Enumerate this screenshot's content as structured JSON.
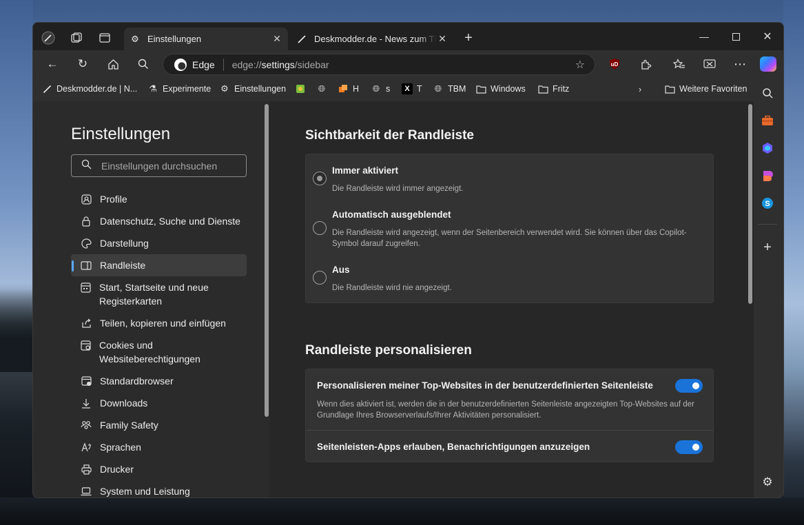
{
  "tabs": [
    {
      "label": "Einstellungen",
      "active": true,
      "icon": "gear-icon"
    },
    {
      "label": "Deskmodder.de - News zum Thema",
      "active": false,
      "icon": "feather-icon"
    }
  ],
  "toolbar": {
    "edge_label": "Edge",
    "url_prefix": "edge://",
    "url_bright": "settings",
    "url_suffix": "/sidebar",
    "ublock_label": "uD"
  },
  "favorites": [
    {
      "label": "Deskmodder.de | N...",
      "icon": "feather-icon"
    },
    {
      "label": "Experimente",
      "icon": "flask-icon"
    },
    {
      "label": "Einstellungen",
      "icon": "gear-icon"
    },
    {
      "label": "",
      "icon": "green-app-icon"
    },
    {
      "label": "",
      "icon": "globe-icon"
    },
    {
      "label": "H",
      "icon": "orange-app-icon"
    },
    {
      "label": "s",
      "icon": "globe-icon"
    },
    {
      "label": "T",
      "icon": "x-logo-icon"
    },
    {
      "label": "TBM",
      "icon": "globe-icon"
    },
    {
      "label": "Windows",
      "icon": "folder-icon"
    },
    {
      "label": "Fritz",
      "icon": "folder-icon"
    },
    {
      "label": "Weitere Favoriten",
      "icon": "folder-icon"
    }
  ],
  "settings": {
    "title": "Einstellungen",
    "search_placeholder": "Einstellungen durchsuchen",
    "nav": [
      {
        "label": "Profile",
        "icon": "profile-icon"
      },
      {
        "label": "Datenschutz, Suche und Dienste",
        "icon": "lock-icon"
      },
      {
        "label": "Darstellung",
        "icon": "palette-icon"
      },
      {
        "label": "Randleiste",
        "icon": "sidebar-icon",
        "selected": true
      },
      {
        "label": "Start, Startseite und neue Registerkarten",
        "icon": "home-grid-icon"
      },
      {
        "label": "Teilen, kopieren und einfügen",
        "icon": "share-icon"
      },
      {
        "label": "Cookies und Websiteberechtigungen",
        "icon": "cookie-icon"
      },
      {
        "label": "Standardbrowser",
        "icon": "browser-icon"
      },
      {
        "label": "Downloads",
        "icon": "download-icon"
      },
      {
        "label": "Family Safety",
        "icon": "family-icon"
      },
      {
        "label": "Sprachen",
        "icon": "language-icon"
      },
      {
        "label": "Drucker",
        "icon": "printer-icon"
      },
      {
        "label": "System und Leistung",
        "icon": "laptop-icon"
      }
    ]
  },
  "visibility": {
    "title": "Sichtbarkeit der Randleiste",
    "options": [
      {
        "label": "Immer aktiviert",
        "desc": "Die Randleiste wird immer angezeigt.",
        "checked": true
      },
      {
        "label": "Automatisch ausgeblendet",
        "desc": "Die Randleiste wird angezeigt, wenn der Seitenbereich verwendet wird. Sie können über das Copilot-Symbol darauf zugreifen.",
        "checked": false
      },
      {
        "label": "Aus",
        "desc": "Die Randleiste wird nie angezeigt.",
        "checked": false
      }
    ]
  },
  "personalize": {
    "title": "Randleiste personalisieren",
    "rows": [
      {
        "title": "Personalisieren meiner Top-Websites in der benutzerdefinierten Seitenleiste",
        "desc": "Wenn dies aktiviert ist, werden die in der benutzerdefinierten Seitenleiste angezeigten Top-Websites auf der Grundlage Ihres Browserverlaufs/Ihrer Aktivitäten personalisiert.",
        "on": true
      },
      {
        "title": "Seitenleisten-Apps erlauben, Benachrichtigungen anzuzeigen",
        "desc": "",
        "on": true
      }
    ]
  },
  "colors": {
    "accent": "#1a73d9",
    "selected_indicator": "#5aa9ff"
  }
}
